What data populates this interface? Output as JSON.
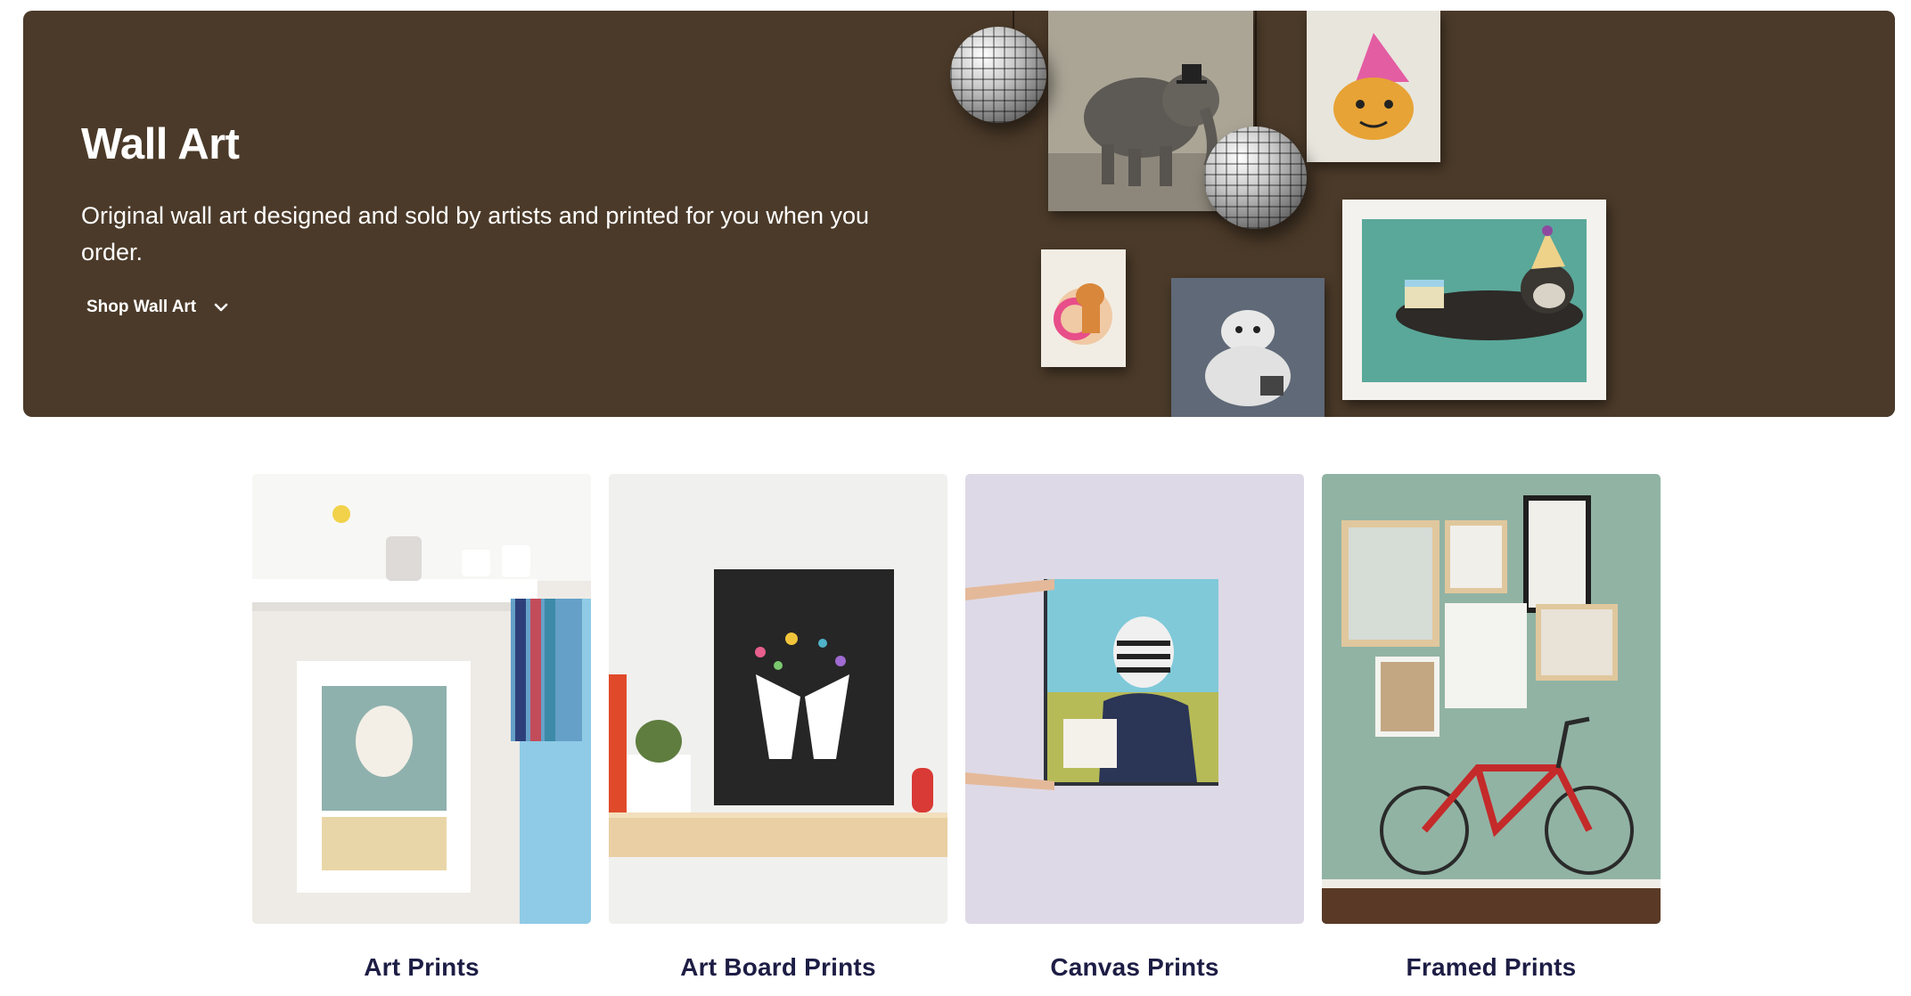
{
  "hero": {
    "title": "Wall Art",
    "description": "Original wall art designed and sold by artists and printed for you when you order.",
    "shop_link_label": "Shop Wall Art",
    "shop_link_icon": "chevron-down-icon",
    "background_color": "#4b3a29"
  },
  "categories": [
    {
      "label": "Art Prints"
    },
    {
      "label": "Art Board Prints"
    },
    {
      "label": "Canvas Prints"
    },
    {
      "label": "Framed Prints"
    }
  ],
  "colors": {
    "category_label": "#1d1d45",
    "hero_text": "#ffffff"
  }
}
